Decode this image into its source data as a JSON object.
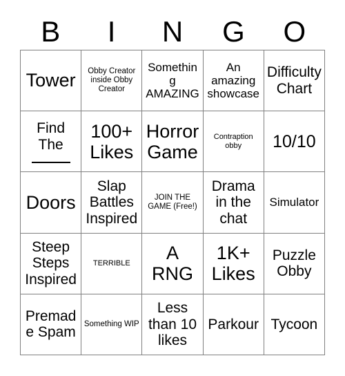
{
  "card": {
    "title": "BINGO",
    "header_letters": [
      "B",
      "I",
      "N",
      "G",
      "O"
    ],
    "grid_size": "5x5",
    "colors": {
      "background": "#ffffff",
      "text": "#000000",
      "grid_line": "#808080"
    },
    "rows": [
      [
        {
          "text": "Tower",
          "size": "fs-xl"
        },
        {
          "text": "Obby Creator inside Obby Creator",
          "size": "fs-xs"
        },
        {
          "text": "Something AMAZING",
          "size": "fs-sm"
        },
        {
          "text": "An amazing showcase",
          "size": "fs-sm"
        },
        {
          "text": "Difficulty Chart",
          "size": "fs-md"
        }
      ],
      [
        {
          "text": "Find The",
          "size": "fs-md",
          "blank": true
        },
        {
          "text": "100+ Likes",
          "size": "fs-xl"
        },
        {
          "text": "Horror Game",
          "size": "fs-xl"
        },
        {
          "text": "Contraption obby",
          "size": "fs-xxs"
        },
        {
          "text": "10/10",
          "size": "fs-lg"
        }
      ],
      [
        {
          "text": "Doors",
          "size": "fs-xl"
        },
        {
          "text": "Slap Battles Inspired",
          "size": "fs-md"
        },
        {
          "text": "JOIN THE GAME (Free!)",
          "size": "fs-xs"
        },
        {
          "text": "Drama in the chat",
          "size": "fs-md"
        },
        {
          "text": "Simulator",
          "size": "fs-sm"
        }
      ],
      [
        {
          "text": "Steep Steps Inspired",
          "size": "fs-md"
        },
        {
          "text": "TERRIBLE",
          "size": "fs-xxs"
        },
        {
          "text": "A RNG",
          "size": "fs-xl"
        },
        {
          "text": "1K+ Likes",
          "size": "fs-xl"
        },
        {
          "text": "Puzzle Obby",
          "size": "fs-md"
        }
      ],
      [
        {
          "text": "Premade Spam",
          "size": "fs-md"
        },
        {
          "text": "Something WIP",
          "size": "fs-xs"
        },
        {
          "text": "Less than 10 likes",
          "size": "fs-md"
        },
        {
          "text": "Parkour",
          "size": "fs-md"
        },
        {
          "text": "Tycoon",
          "size": "fs-md"
        }
      ]
    ]
  }
}
